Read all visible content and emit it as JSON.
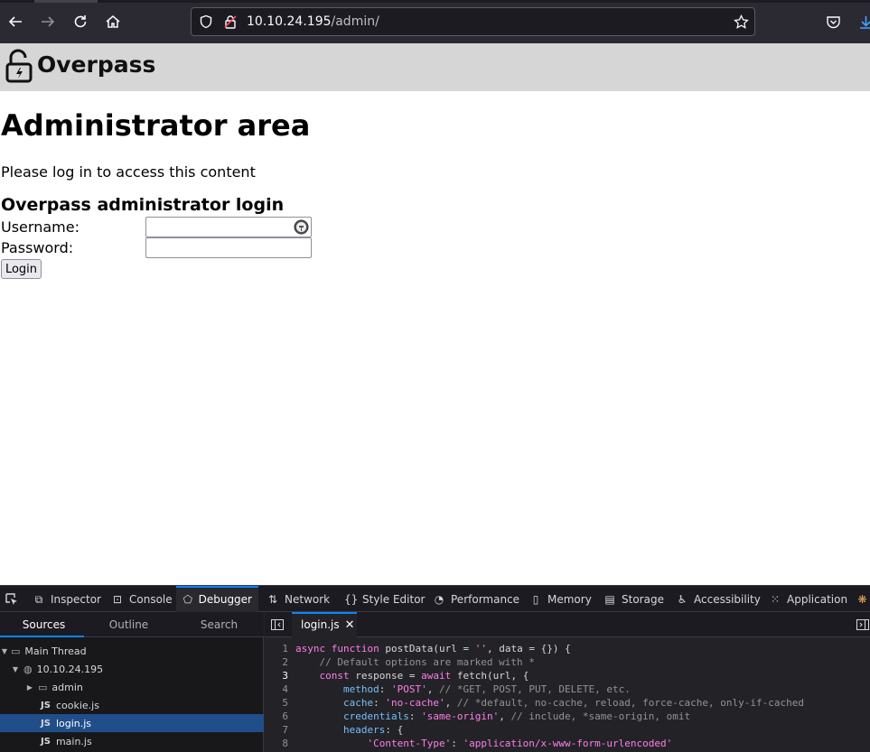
{
  "browser": {
    "url_host": "10.10.24.195",
    "url_path": "/admin/"
  },
  "site": {
    "brand": "Overpass"
  },
  "page": {
    "heading": "Administrator area",
    "intro": "Please log in to access this content",
    "form_title": "Overpass administrator login",
    "username_label": "Username:",
    "password_label": "Password:",
    "username_value": "",
    "password_value": "",
    "login_button": "Login"
  },
  "devtools": {
    "tabs": [
      {
        "label": "Inspector",
        "icon": "inspector-icon"
      },
      {
        "label": "Console",
        "icon": "console-icon"
      },
      {
        "label": "Debugger",
        "icon": "debugger-icon"
      },
      {
        "label": "Network",
        "icon": "network-icon"
      },
      {
        "label": "Style Editor",
        "icon": "style-editor-icon"
      },
      {
        "label": "Performance",
        "icon": "performance-icon"
      },
      {
        "label": "Memory",
        "icon": "memory-icon"
      },
      {
        "label": "Storage",
        "icon": "storage-icon"
      },
      {
        "label": "Accessibility",
        "icon": "accessibility-icon"
      },
      {
        "label": "Application",
        "icon": "application-icon"
      }
    ],
    "active_tab": "Debugger",
    "source_tabs": [
      "Sources",
      "Outline",
      "Search"
    ],
    "tree": {
      "thread": "Main Thread",
      "host": "10.10.24.195",
      "folder": "admin",
      "files": [
        "cookie.js",
        "login.js",
        "main.js"
      ],
      "selected": "login.js"
    },
    "open_file": "login.js",
    "code": [
      "async function postData(url = '', data = {}) {",
      "    // Default options are marked with *",
      "    const response = await fetch(url, {",
      "        method: 'POST', // *GET, POST, PUT, DELETE, etc.",
      "        cache: 'no-cache', // *default, no-cache, reload, force-cache, only-if-cached",
      "        credentials: 'same-origin', // include, *same-origin, omit",
      "        headers: {",
      "            'Content-Type': 'application/x-www-form-urlencoded'"
    ],
    "current_line": 3,
    "colors": {
      "keyword": "#ff7de9",
      "string": "#ff7de9",
      "comment": "#939395",
      "property": "#75bfff",
      "identifier": "#d7d7db",
      "accent": "#0a84ff"
    }
  }
}
